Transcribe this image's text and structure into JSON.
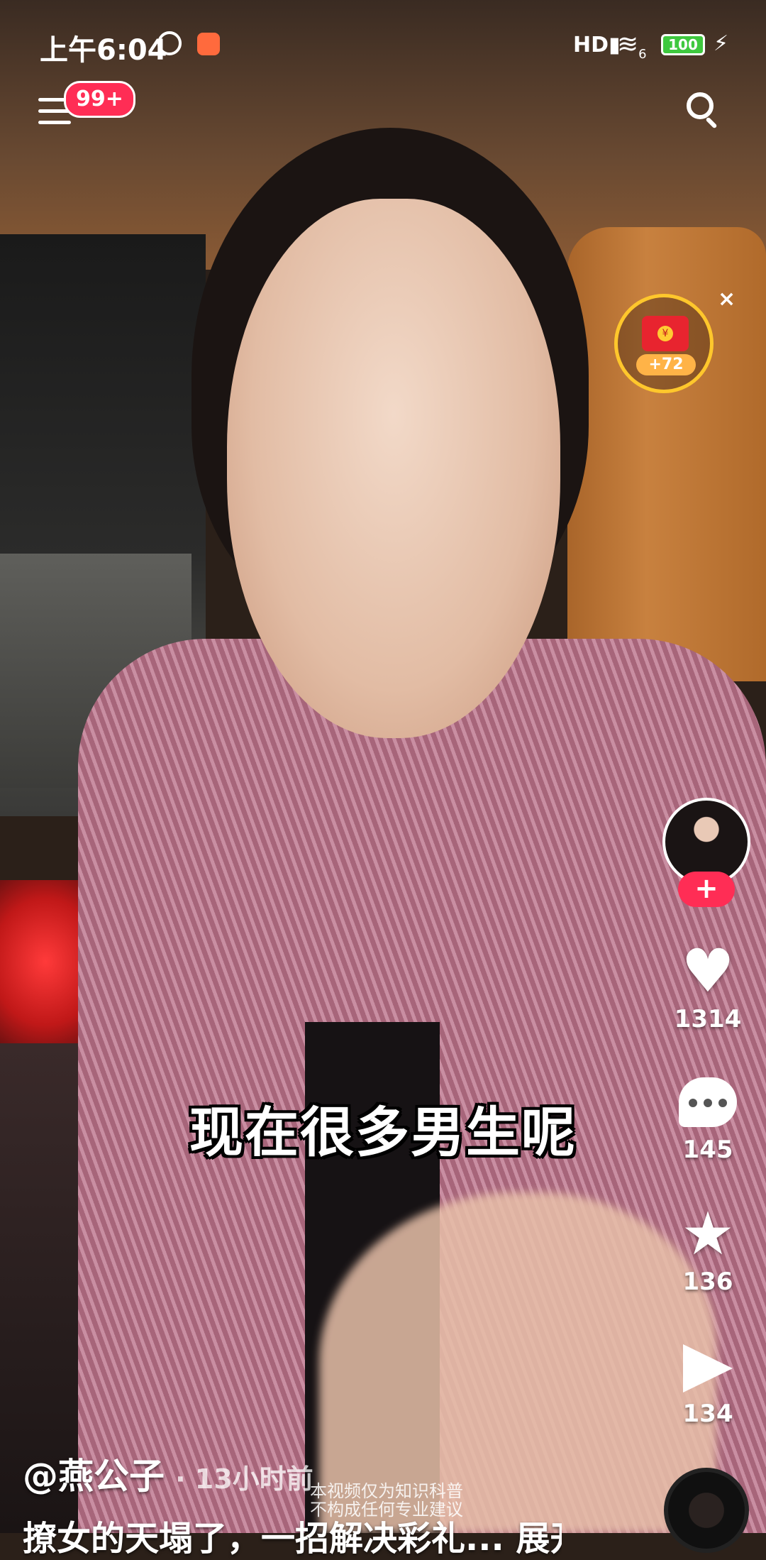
{
  "status_bar": {
    "time": "上午6:04",
    "network": "HD",
    "wifi": "6",
    "battery": "100"
  },
  "top_bar": {
    "menu_badge": "99+"
  },
  "red_packet": {
    "amount": "+72",
    "coin_symbol": "¥",
    "close": "×"
  },
  "actions": {
    "follow": "+",
    "like_count": "1314",
    "comment_count": "145",
    "favorite_count": "136",
    "share_count": "134"
  },
  "video": {
    "subtitle": "现在很多男生呢",
    "author": "@燕公子",
    "time_ago": "· 13小时前",
    "disclaimer": "本视频仅为知识科普 不构成任何专业建议",
    "caption": "撩女的天塌了，一招解决彩礼... 展开"
  },
  "colors": {
    "accent_pink": "#ff2d55",
    "red_packet_ring": "#ffc72c",
    "battery_green": "#3ec83e"
  },
  "icons": [
    "menu-icon",
    "search-icon",
    "heart-icon",
    "comment-icon",
    "star-icon",
    "share-icon",
    "alarm-icon",
    "wifi-icon",
    "signal-icon",
    "charging-icon"
  ]
}
